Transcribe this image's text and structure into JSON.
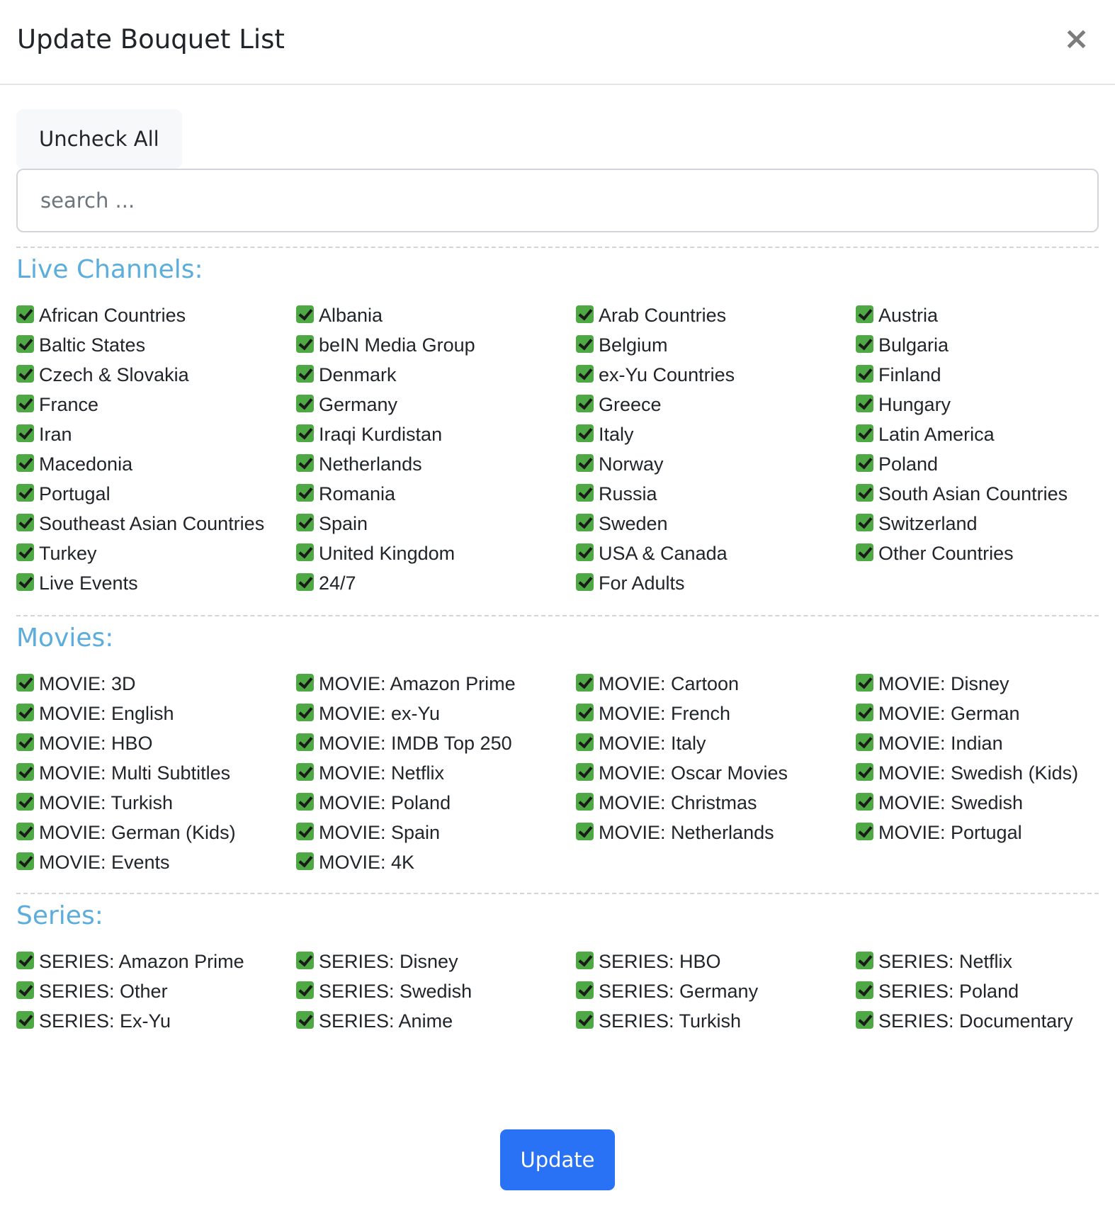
{
  "dialog": {
    "title": "Update Bouquet List",
    "close_label": "×",
    "uncheck_all_label": "Uncheck All",
    "search_placeholder": "search ...",
    "update_label": "Update"
  },
  "colors": {
    "section_title": "#5aaddc",
    "checkbox": "#4ea843",
    "primary_button": "#2a72f5"
  },
  "sections": [
    {
      "title": "Live Channels:",
      "items": [
        "African Countries",
        "Albania",
        "Arab Countries",
        "Austria",
        "Baltic States",
        "beIN Media Group",
        "Belgium",
        "Bulgaria",
        "Czech & Slovakia",
        "Denmark",
        "ex-Yu Countries",
        "Finland",
        "France",
        "Germany",
        "Greece",
        "Hungary",
        "Iran",
        "Iraqi Kurdistan",
        "Italy",
        "Latin America",
        "Macedonia",
        "Netherlands",
        "Norway",
        "Poland",
        "Portugal",
        "Romania",
        "Russia",
        "South Asian Countries",
        "Southeast Asian Countries",
        "Spain",
        "Sweden",
        "Switzerland",
        "Turkey",
        "United Kingdom",
        "USA & Canada",
        "Other Countries",
        "Live Events",
        "24/7",
        "For Adults"
      ]
    },
    {
      "title": "Movies:",
      "items": [
        "MOVIE: 3D",
        "MOVIE: Amazon Prime",
        "MOVIE: Cartoon",
        "MOVIE: Disney",
        "MOVIE: English",
        "MOVIE: ex-Yu",
        "MOVIE: French",
        "MOVIE: German",
        "MOVIE: HBO",
        "MOVIE: IMDB Top 250",
        "MOVIE: Italy",
        "MOVIE: Indian",
        "MOVIE: Multi Subtitles",
        "MOVIE: Netflix",
        "MOVIE: Oscar Movies",
        "MOVIE: Swedish (Kids)",
        "MOVIE: Turkish",
        "MOVIE: Poland",
        "MOVIE: Christmas",
        "MOVIE: Swedish",
        "MOVIE: German (Kids)",
        "MOVIE: Spain",
        "MOVIE: Netherlands",
        "MOVIE: Portugal",
        "MOVIE: Events",
        "MOVIE: 4K"
      ]
    },
    {
      "title": "Series:",
      "items": [
        "SERIES: Amazon Prime",
        "SERIES: Disney",
        "SERIES: HBO",
        "SERIES: Netflix",
        "SERIES: Other",
        "SERIES: Swedish",
        "SERIES: Germany",
        "SERIES: Poland",
        "SERIES: Ex-Yu",
        "SERIES: Anime",
        "SERIES: Turkish",
        "SERIES: Documentary"
      ]
    }
  ]
}
